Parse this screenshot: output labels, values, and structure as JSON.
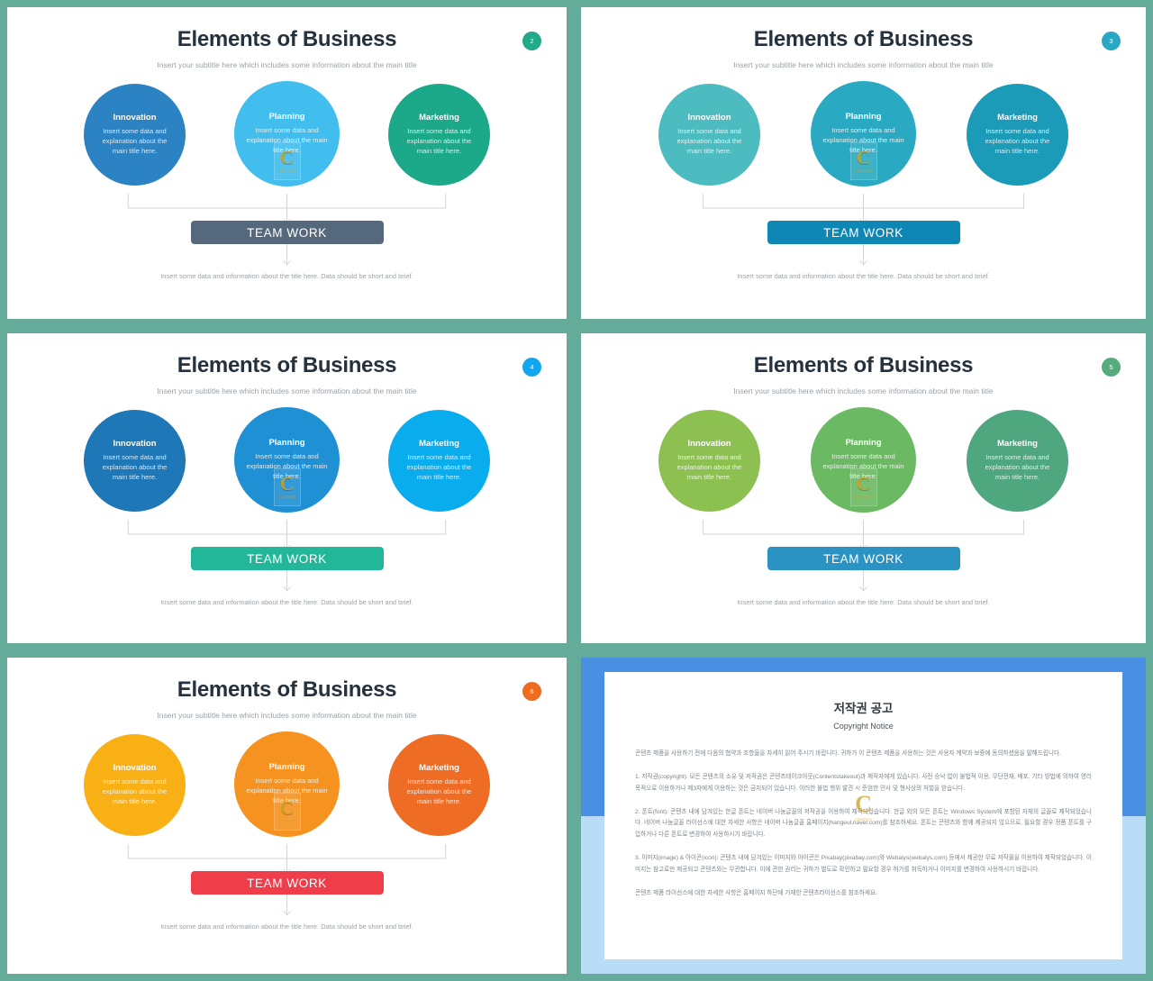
{
  "theme": {
    "outer_frame_color": "#64ab99",
    "slide_bg": "#ffffff"
  },
  "slide_common": {
    "title": "Elements of Business",
    "subtitle": "Insert your subtitle here which includes some information about the main title",
    "teamwork_label": "TEAM WORK",
    "bottom_note": "Insert some data and information about the title here. Data should be short and brief.",
    "items": [
      {
        "title": "Innovation",
        "desc": "Insert some data and explanation about the main title here."
      },
      {
        "title": "Planning",
        "desc": "Insert some data and explanation about the main title here."
      },
      {
        "title": "Marketing",
        "desc": "Insert some data and explanation about the main title here."
      }
    ],
    "watermark": {
      "letter": "C",
      "sub": "CONTENTS"
    }
  },
  "slides": [
    {
      "page_number": "2",
      "badge_color": "#22a98a",
      "circle_colors": [
        "#2c83c3",
        "#41bdee",
        "#1ba98a"
      ],
      "teamwork_color": "#56697c",
      "line_color": "#cfd6db"
    },
    {
      "page_number": "3",
      "badge_color": "#2aa7c4",
      "circle_colors": [
        "#4cbcc0",
        "#29aac2",
        "#1b9bb8"
      ],
      "teamwork_color": "#0f87b5",
      "line_color": "#cfd6db"
    },
    {
      "page_number": "4",
      "badge_color": "#11a6ef",
      "circle_colors": [
        "#1e78b8",
        "#2090d4",
        "#09aced"
      ],
      "teamwork_color": "#23b79a",
      "line_color": "#cfd6db"
    },
    {
      "page_number": "5",
      "badge_color": "#55ab7c",
      "circle_colors": [
        "#8cc152",
        "#6cb964",
        "#4fa780"
      ],
      "teamwork_color": "#2a93c4",
      "line_color": "#cfd6db"
    },
    {
      "page_number": "6",
      "badge_color": "#ee6b20",
      "circle_colors": [
        "#f9b015",
        "#f69220",
        "#ef6c25"
      ],
      "teamwork_color": "#ef3e4a",
      "line_color": "#cfd6db"
    }
  ],
  "copyright": {
    "bg_top": "#4a90e2",
    "bg_bottom": "#b9ddf7",
    "title": "저작권 공고",
    "subtitle": "Copyright Notice",
    "paragraphs": [
      "콘텐츠 제품을 사용하기 전에 다음의 협약과 조항들을 자세히 읽어 주시기 바랍니다. 귀하가 이 콘텐츠 제품을 사용하는 것은 사용자 계약과 보증에 동의하셨음을 말해드립니다.",
      "1. 저작권(copyright): 모든 콘텐츠의 소유 및 저작권은 콘텐츠테이크아웃(Contentstakeout)과 제작자에게 있습니다. 사전 승낙 없이 불법적 이용, 무단전재, 배포, 기타 방법에 의하여 영리 목적으로 이용하거나 제3자에게 이용하는 것은 금지되어 있습니다. 이러한 불법 행위 발견 시 준엄한 민사 및 형사상의 처벌을 받습니다.",
      "2. 폰트(font): 콘텐츠 내에 담겨있는 한글 폰트는 네이버 나눔글꼴의 저작권을 이용하여 제작되었습니다. 한글 외의 모든 폰트는 Windows System에 포함된 자체의 글꼴로 제작되었습니다. 네이버 나눔글꼴 라이선스에 대한 자세한 사항은 네이버 나눔글꼴 홈페이지(hangeul.naver.com)를 참조하세요. 폰트는 콘텐츠와 함께 제공되지 않으므로, 필요할 경우 정품 폰트를 구입하거나 다른 폰트로 변경하여 사용하시기 바랍니다.",
      "3. 이미지(image) & 아이콘(icon): 콘텐츠 내에 담겨있는 이미지와 아이콘은 Pixabay(pixabay.com)와 Webalys(webalys.com) 등에서 제공한 무료 저작물을 이용하여 제작되었습니다. 이미지는 참고로만 제공되고 콘텐츠와는 무관합니다. 이에 관한 권리는 귀하가 별도로 확인하고 필요할 경우 허가를 취득하거나 이미지를 변경하여 사용하시기 바랍니다.",
      "콘텐츠 제품 라이선스에 대한 자세한 사항은 홈페이지 하단에 기재한 콘텐츠라이선스를 참조하세요."
    ],
    "watermark": {
      "letter": "C",
      "sub": "CONTENTS"
    }
  }
}
